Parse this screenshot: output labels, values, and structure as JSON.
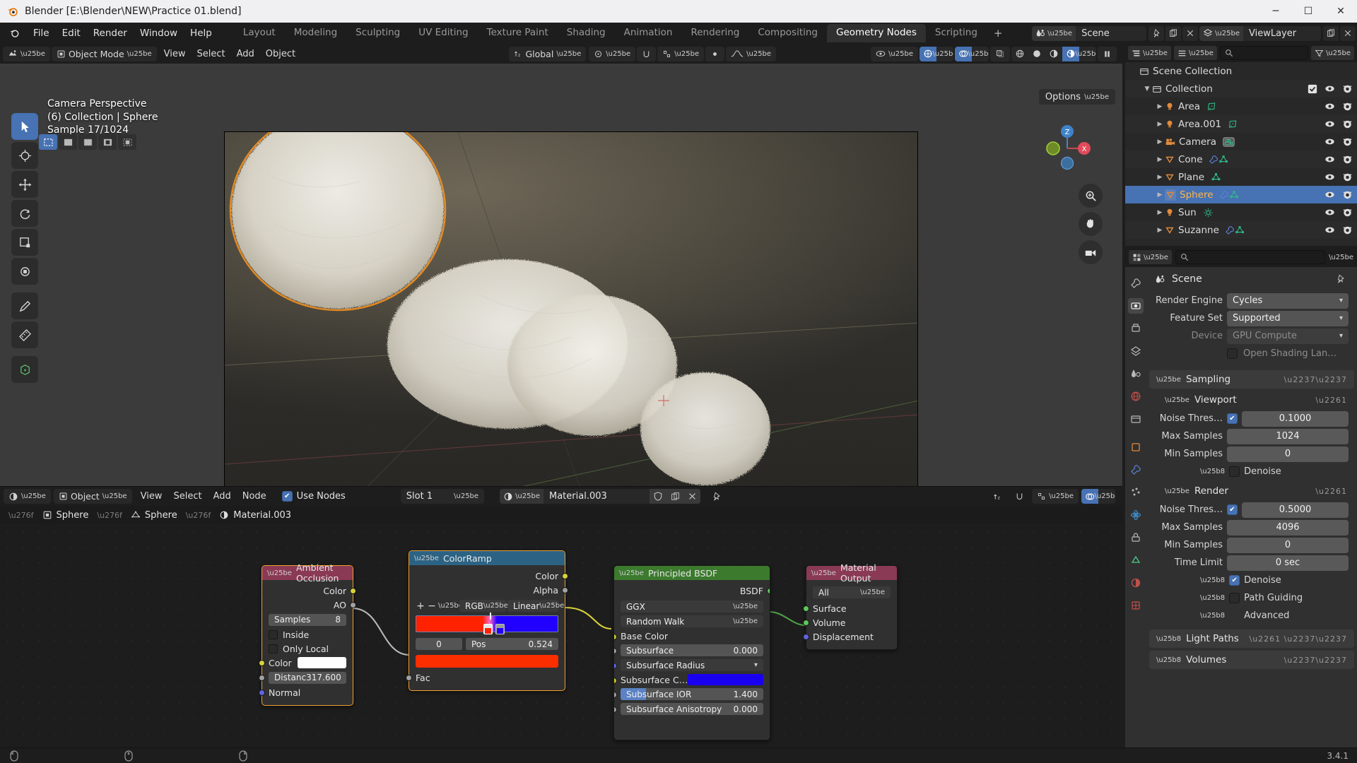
{
  "window": {
    "title": "Blender [E:\\Blender\\NEW\\Practice 01.blend]",
    "minimize": "─",
    "maximize": "☐",
    "close": "✕"
  },
  "menubar": {
    "items": [
      "File",
      "Edit",
      "Render",
      "Window",
      "Help"
    ]
  },
  "workspaces": {
    "tabs": [
      "Layout",
      "Modeling",
      "Sculpting",
      "UV Editing",
      "Texture Paint",
      "Shading",
      "Animation",
      "Rendering",
      "Compositing",
      "Geometry Nodes",
      "Scripting"
    ],
    "active": "Geometry Nodes",
    "add_label": "+"
  },
  "topbar_right": {
    "scene_name": "Scene",
    "viewlayer_name": "ViewLayer"
  },
  "viewport": {
    "mode": "Object Mode",
    "menus": [
      "View",
      "Select",
      "Add",
      "Object"
    ],
    "transform_orientation": "Global",
    "overlay_lines": [
      "Camera Perspective",
      "(6) Collection | Sphere",
      "Sample 17/1024"
    ],
    "options_label": "Options",
    "gizmo_axes": [
      "Z",
      "X"
    ]
  },
  "outliner": {
    "header_search_placeholder": "",
    "rows": [
      {
        "label": "Scene Collection",
        "indent": 0,
        "icon": "collection-icon",
        "arrow": "",
        "selected": false,
        "show_checkbox": false,
        "show_eye": false,
        "show_camera": false
      },
      {
        "label": "Collection",
        "indent": 1,
        "icon": "collection-icon",
        "arrow": "▼",
        "selected": false,
        "show_checkbox": true,
        "show_eye": true,
        "show_camera": true
      },
      {
        "label": "Area",
        "indent": 2,
        "icon": "light-icon",
        "arrow": "▶",
        "selected": false,
        "show_checkbox": false,
        "show_eye": true,
        "show_camera": true,
        "data_icon": "area-light-data-icon"
      },
      {
        "label": "Area.001",
        "indent": 2,
        "icon": "light-icon",
        "arrow": "▶",
        "selected": false,
        "show_checkbox": false,
        "show_eye": true,
        "show_camera": true,
        "data_icon": "area-light-data-icon"
      },
      {
        "label": "Camera",
        "indent": 2,
        "icon": "camera-icon",
        "arrow": "▶",
        "selected": false,
        "show_checkbox": false,
        "show_eye": true,
        "show_camera": true,
        "data_icon": "camera-data-icon"
      },
      {
        "label": "Cone",
        "indent": 2,
        "icon": "mesh-icon",
        "arrow": "▶",
        "selected": false,
        "show_checkbox": false,
        "show_eye": true,
        "show_camera": true,
        "data_icon": "modifier-icon"
      },
      {
        "label": "Plane",
        "indent": 2,
        "icon": "mesh-icon",
        "arrow": "▶",
        "selected": false,
        "show_checkbox": false,
        "show_eye": true,
        "show_camera": true,
        "data_icon": "mesh-data-icon"
      },
      {
        "label": "Sphere",
        "indent": 2,
        "icon": "mesh-icon",
        "arrow": "▶",
        "selected": true,
        "show_checkbox": false,
        "show_eye": true,
        "show_camera": true,
        "data_icon": "modifier-icon"
      },
      {
        "label": "Sun",
        "indent": 2,
        "icon": "light-icon",
        "arrow": "▶",
        "selected": false,
        "show_checkbox": false,
        "show_eye": true,
        "show_camera": true,
        "data_icon": "sun-data-icon"
      },
      {
        "label": "Suzanne",
        "indent": 2,
        "icon": "mesh-icon",
        "arrow": "▶",
        "selected": false,
        "show_checkbox": false,
        "show_eye": true,
        "show_camera": true,
        "data_icon": "modifier-icon"
      }
    ]
  },
  "properties": {
    "breadcrumb_title": "Scene",
    "fields": [
      {
        "label": "Render Engine",
        "value": "Cycles",
        "type": "dropdown",
        "dim": false
      },
      {
        "label": "Feature Set",
        "value": "Supported",
        "type": "dropdown",
        "dim": false
      },
      {
        "label": "Device",
        "value": "GPU Compute",
        "type": "dropdown",
        "dim": true
      }
    ],
    "osl_label": "Open Shading Lan…",
    "sections": {
      "sampling": "Sampling",
      "viewport": "Viewport",
      "render": "Render",
      "denoise": "Denoise",
      "path_guiding": "Path Guiding",
      "advanced": "Advanced",
      "light_paths": "Light Paths",
      "volumes": "Volumes"
    },
    "viewport_sampling": [
      {
        "label": "Noise Thres…",
        "value": "0.1000",
        "checkbox": true
      },
      {
        "label": "Max Samples",
        "value": "1024",
        "checkbox": false
      },
      {
        "label": "Min Samples",
        "value": "0",
        "checkbox": false
      }
    ],
    "render_sampling": [
      {
        "label": "Noise Thres…",
        "value": "0.5000",
        "checkbox": true
      },
      {
        "label": "Max Samples",
        "value": "4096",
        "checkbox": false
      },
      {
        "label": "Min Samples",
        "value": "0",
        "checkbox": false
      },
      {
        "label": "Time Limit",
        "value": "0 sec",
        "checkbox": false
      }
    ]
  },
  "shader_editor": {
    "mode": "Object",
    "menus": [
      "View",
      "Select",
      "Add",
      "Node"
    ],
    "use_nodes_label": "Use Nodes",
    "use_nodes_checked": true,
    "slot": "Slot 1",
    "material_name": "Material.003",
    "breadcrumb": [
      "Sphere",
      "Sphere",
      "Material.003"
    ]
  },
  "nodes": {
    "ambient_occlusion": {
      "title": "Ambient Occlusion",
      "header_color": "#8a3a54",
      "outputs": [
        "Color",
        "AO"
      ],
      "samples_label": "Samples",
      "samples_value": "8",
      "inside_label": "Inside",
      "only_local_label": "Only Local",
      "color_label": "Color",
      "color_value": "#ffffff",
      "distance_label": "Distanc",
      "distance_value": "317.600",
      "normal_label": "Normal"
    },
    "color_ramp": {
      "title": "ColorRamp",
      "header_color": "#2c6384",
      "outputs": [
        "Color",
        "Alpha"
      ],
      "add_label": "+",
      "remove_label": "−",
      "interpolation_mode": "RGB",
      "interpolation_type": "Linear",
      "index_value": "0",
      "pos_label": "Pos",
      "pos_value": "0.524",
      "stop_left_color": "#ff2200",
      "stop_right_color": "#2200ff",
      "active_color": "#fb2e00",
      "input_label": "Fac"
    },
    "principled_bsdf": {
      "title": "Principled BSDF",
      "header_color": "#3c7a2e",
      "output": "BSDF",
      "distribution": "GGX",
      "subsurface_method": "Random Walk",
      "rows": [
        {
          "label": "Base Color",
          "value": "",
          "type": "socket",
          "socket": "#c7c729"
        },
        {
          "label": "Subsurface",
          "value": "0.000",
          "type": "slider",
          "socket": "#a1a1a1"
        },
        {
          "label": "Subsurface Radius",
          "value": "",
          "type": "dropdown",
          "socket": "#6363e0"
        },
        {
          "label": "Subsurface C…",
          "value": "#1a00f0",
          "type": "color",
          "socket": "#c7c729"
        },
        {
          "label": "Subsurface IOR",
          "value": "1.400",
          "type": "slider",
          "socket": "#a1a1a1",
          "fill": 0.18
        },
        {
          "label": "Subsurface Anisotropy",
          "value": "0.000",
          "type": "slider",
          "socket": "#a1a1a1"
        }
      ]
    },
    "material_output": {
      "title": "Material Output",
      "header_color": "#8a3a54",
      "target": "All",
      "inputs": [
        {
          "label": "Surface",
          "socket": "#5cc85c"
        },
        {
          "label": "Volume",
          "socket": "#5cc85c"
        },
        {
          "label": "Displacement",
          "socket": "#6363e0"
        }
      ]
    }
  },
  "statusbar": {
    "hints": [
      "",
      "",
      ""
    ],
    "version": "3.4.1"
  }
}
